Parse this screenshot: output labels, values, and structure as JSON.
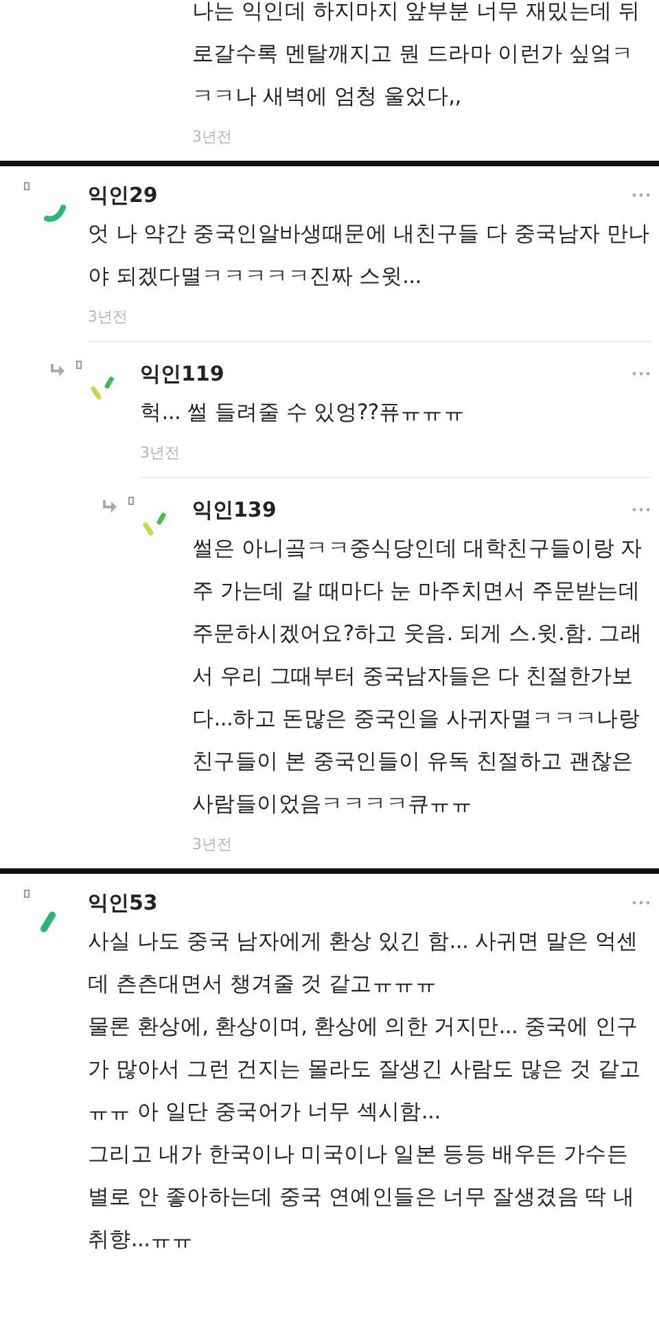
{
  "sections": [
    {
      "comments": [
        {
          "kind": "continuation",
          "text": "나는 익인데 하지마지 앞부분 너무 재밌는데 뒤로갈수록 멘탈깨지고 뭔 드라마 이런가 싶엌ㅋㅋㅋ나 새벽에 엄청 울었다,,",
          "time": "3년전"
        }
      ]
    },
    {
      "comments": [
        {
          "kind": "comment",
          "name": "익인29",
          "avatar": {
            "kind": "arc"
          },
          "text": "엇 나 약간 중국인알바생때문에 내친구들 다 중국남자 만나야 되겠다멸ㅋㅋㅋㅋㅋ진짜 스윗...",
          "time": "3년전",
          "children": [
            {
              "kind": "comment",
              "name": "익인119",
              "avatar": {
                "kind": "dashes"
              },
              "text": "헉... 썰 들려줄 수 있엉??퓨ㅠㅠㅠ",
              "time": "3년전",
              "children": [
                {
                  "kind": "comment",
                  "name": "익인139",
                  "avatar": {
                    "kind": "dashes"
                  },
                  "text": "썰은 아니곸ㅋㅋ중식당인데 대학친구들이랑 자주 가는데 갈 때마다 눈 마주치면서 주문받는데 주문하시겠어요?하고 웃음. 되게 스.윗.함. 그래서 우리 그때부터 중국남자들은 다 친절한가보다...하고 돈많은 중국인을 사귀자멸ㅋㅋㅋ나랑 친구들이 본 중국인들이 유독 친절하고 괜찮은 사람들이었음ㅋㅋㅋㅋ큐ㅠㅠ",
                  "time": "3년전"
                }
              ]
            }
          ]
        }
      ]
    },
    {
      "comments": [
        {
          "kind": "comment",
          "name": "익인53",
          "avatar": {
            "kind": "bar"
          },
          "text": "사실 나도 중국 남자에게 환상 있긴 함... 사귀면 말은 억센데 츤츤대면서 챙겨줄 것 같고ㅠㅠㅠ\n물론 환상에, 환상이며, 환상에 의한 거지만... 중국에 인구가 많아서 그런 건지는 몰라도 잘생긴 사람도 많은 것 같고 ㅠㅠ 아 일단 중국어가 너무 섹시함...\n그리고 내가 한국이나 미국이나 일본 등등 배우든 가수든 별로 안 좋아하는데 중국 연예인들은 너무 잘생겼음 딱 내 취향...ㅠㅠ"
        }
      ]
    }
  ]
}
